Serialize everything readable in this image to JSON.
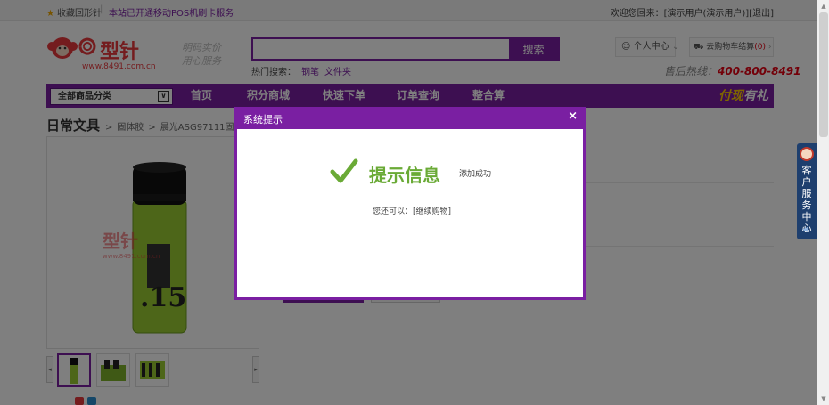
{
  "topbar": {
    "favorite": "收藏回形针",
    "separator": "|",
    "notice": "本站已开通移动POS机刷卡服务",
    "welcome": "欢迎您回来：",
    "user": "[演示用户(演示用户)]",
    "logout": "[退出]"
  },
  "header": {
    "logo_text": "型针",
    "logo_url": "www.8491.com.cn",
    "slogan_line1": "明码实价",
    "slogan_line2": "用心服务",
    "search_placeholder": "",
    "search_button": "搜索",
    "hot_label": "热门搜索：",
    "hot_keywords": [
      "钢笔",
      "文件夹"
    ],
    "user_center": "个人中心",
    "cart_label": "去购物车结算",
    "cart_count": "(0)",
    "hotline_label": "售后热线：",
    "hotline_number": "400-800-8491"
  },
  "nav": {
    "all_categories": "全部商品分类",
    "items": [
      "首页",
      "积分商城",
      "快速下单",
      "订单查询",
      "整合算"
    ],
    "promo_a": "付现",
    "promo_b": "有礼"
  },
  "breadcrumb": {
    "category": "日常文具",
    "sep": ">",
    "sub": "固体胶",
    "product": "晨光ASG97111固体胶棒"
  },
  "product": {
    "watermark": "型针",
    "watermark_url": "www.8491.com.cn"
  },
  "dialog": {
    "title": "系统提示",
    "close": "×",
    "heading": "提示信息",
    "message": "添加成功",
    "next_label": "您还可以：",
    "continue_link": "[继续购物]"
  },
  "service_tab": {
    "text": "客户服务中心"
  },
  "colors": {
    "brand_purple": "#7a1fa2",
    "success_green": "#6aaa36",
    "hotline_red": "#e60012"
  }
}
